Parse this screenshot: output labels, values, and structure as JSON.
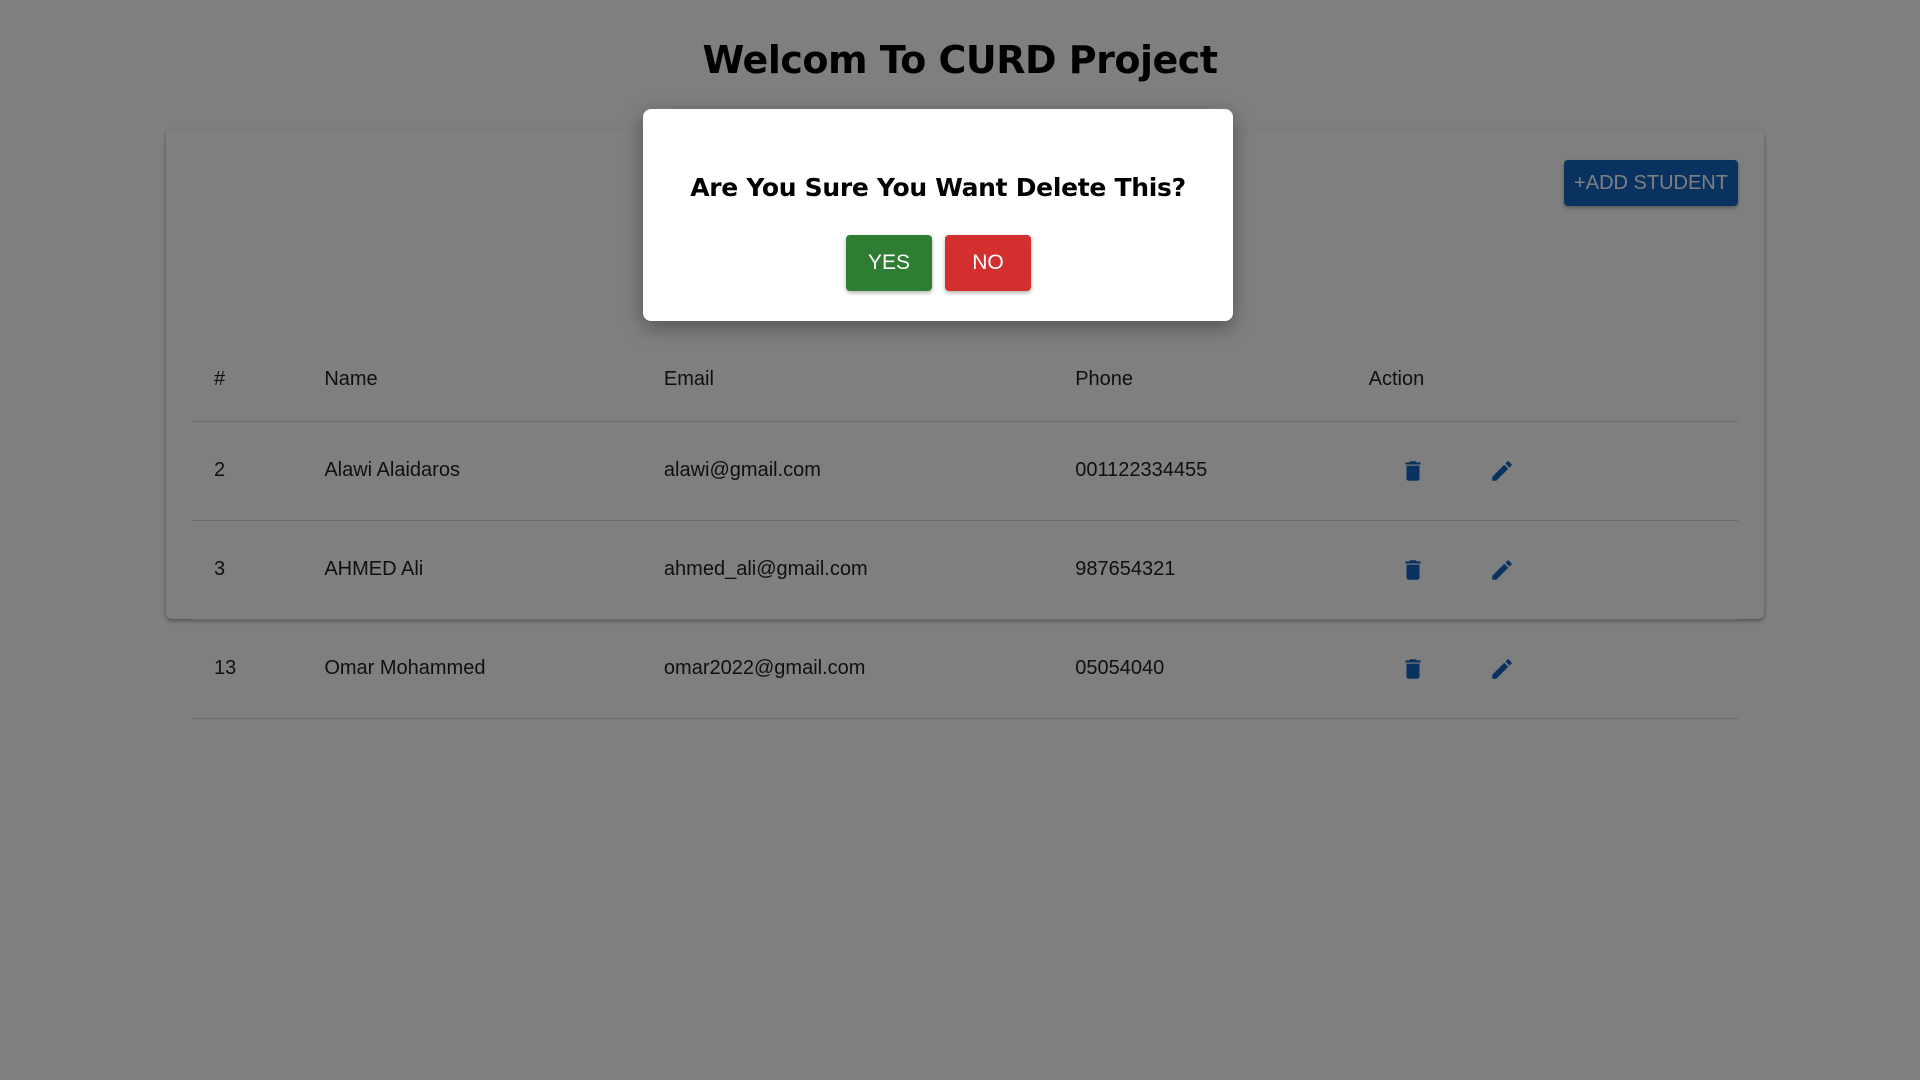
{
  "header": {
    "title": "Welcom To CURD Project"
  },
  "toolbar": {
    "add_label": "+ADD STUDENT"
  },
  "table": {
    "headers": [
      "#",
      "Name",
      "Email",
      "Phone",
      "Action"
    ],
    "rows": [
      {
        "id": "2",
        "name": "Alawi Alaidaros",
        "email": "alawi@gmail.com",
        "phone": "001122334455"
      },
      {
        "id": "3",
        "name": "AHMED Ali",
        "email": "ahmed_ali@gmail.com",
        "phone": "987654321"
      },
      {
        "id": "13",
        "name": "Omar Mohammed",
        "email": "omar2022@gmail.com",
        "phone": "05054040"
      }
    ]
  },
  "dialog": {
    "title": "Are You Sure You Want Delete This?",
    "yes_label": "YES",
    "no_label": "NO"
  },
  "icons": {
    "delete": "trash-icon",
    "edit": "pencil-icon"
  },
  "colors": {
    "primary": "#1565c0",
    "confirm": "#2e7d32",
    "cancel": "#d32f2f",
    "backdrop": "rgba(0,0,0,0.5)"
  }
}
